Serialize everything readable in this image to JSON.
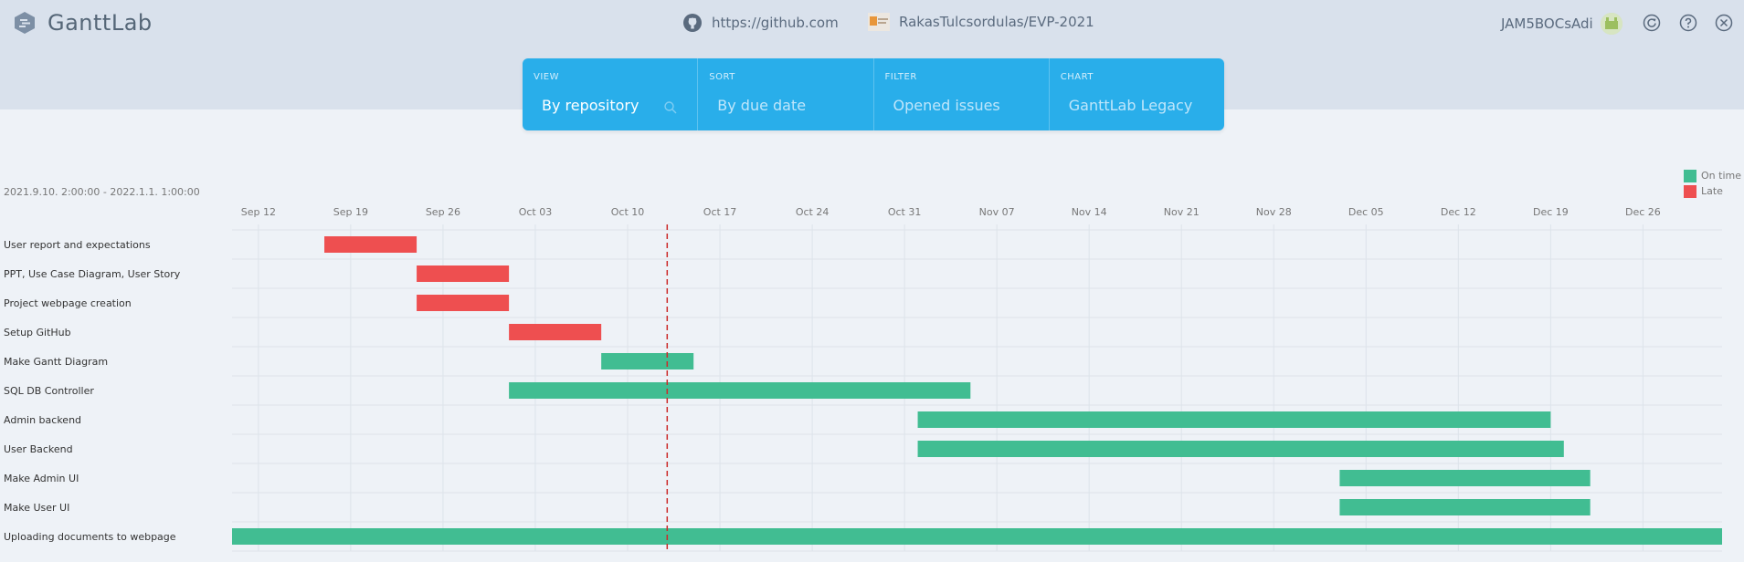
{
  "app": {
    "title": "GanttLab",
    "source_url": "https://github.com",
    "project": "RakasTulcsordulas/EVP-2021",
    "username": "JAM5BOCsAdi"
  },
  "controls": {
    "view": {
      "label": "VIEW",
      "value": "By repository"
    },
    "sort": {
      "label": "SORT",
      "value": "By due date"
    },
    "filter": {
      "label": "FILTER",
      "value": "Opened issues"
    },
    "chart": {
      "label": "CHART",
      "value": "GanttLab Legacy"
    }
  },
  "icons": {
    "logo": "gantt-logo-icon",
    "source": "github-icon",
    "project": "project-avatar-icon",
    "user": "user-avatar-icon",
    "refresh": "refresh-icon",
    "help": "help-icon",
    "close": "close-icon",
    "search": "search-icon"
  },
  "colors": {
    "header_bg": "#d9e1ec",
    "panel_bg": "#29aeea",
    "on_time": "#41bd92",
    "late": "#ee4f50",
    "today_line": "#cc2b2b",
    "grid": "#dde3ea"
  },
  "chart_data": {
    "type": "gantt",
    "date_range": "2021.9.10. 2:00:00 - 2022.1.1. 1:00:00",
    "x_axis": {
      "start": "2021-09-10",
      "end": "2022-01-01",
      "ticks": [
        {
          "label": "Sep 12",
          "date": "2021-09-12"
        },
        {
          "label": "Sep 19",
          "date": "2021-09-19"
        },
        {
          "label": "Sep 26",
          "date": "2021-09-26"
        },
        {
          "label": "Oct 03",
          "date": "2021-10-03"
        },
        {
          "label": "Oct 10",
          "date": "2021-10-10"
        },
        {
          "label": "Oct 17",
          "date": "2021-10-17"
        },
        {
          "label": "Oct 24",
          "date": "2021-10-24"
        },
        {
          "label": "Oct 31",
          "date": "2021-10-31"
        },
        {
          "label": "Nov 07",
          "date": "2021-11-07"
        },
        {
          "label": "Nov 14",
          "date": "2021-11-14"
        },
        {
          "label": "Nov 21",
          "date": "2021-11-21"
        },
        {
          "label": "Nov 28",
          "date": "2021-11-28"
        },
        {
          "label": "Dec 05",
          "date": "2021-12-05"
        },
        {
          "label": "Dec 12",
          "date": "2021-12-12"
        },
        {
          "label": "Dec 19",
          "date": "2021-12-19"
        },
        {
          "label": "Dec 26",
          "date": "2021-12-26"
        }
      ]
    },
    "today": "2021-10-13",
    "legend": [
      {
        "name": "On time",
        "color": "#41bd92"
      },
      {
        "name": "Late",
        "color": "#ee4f50"
      }
    ],
    "tasks": [
      {
        "name": "User report and expectations",
        "start": "2021-09-17",
        "end": "2021-09-24",
        "status": "Late"
      },
      {
        "name": "PPT, Use Case Diagram, User Story",
        "start": "2021-09-24",
        "end": "2021-10-01",
        "status": "Late"
      },
      {
        "name": "Project webpage creation",
        "start": "2021-09-24",
        "end": "2021-10-01",
        "status": "Late"
      },
      {
        "name": "Setup GitHub",
        "start": "2021-10-01",
        "end": "2021-10-08",
        "status": "Late"
      },
      {
        "name": "Make Gantt Diagram",
        "start": "2021-10-08",
        "end": "2021-10-15",
        "status": "On time"
      },
      {
        "name": "SQL DB Controller",
        "start": "2021-10-01",
        "end": "2021-11-05",
        "status": "On time"
      },
      {
        "name": "Admin backend",
        "start": "2021-11-01",
        "end": "2021-12-19",
        "status": "On time"
      },
      {
        "name": "User Backend",
        "start": "2021-11-01",
        "end": "2021-12-20",
        "status": "On time"
      },
      {
        "name": "Make Admin UI",
        "start": "2021-12-03",
        "end": "2021-12-22",
        "status": "On time"
      },
      {
        "name": "Make User UI",
        "start": "2021-12-03",
        "end": "2021-12-22",
        "status": "On time"
      },
      {
        "name": "Uploading documents to webpage",
        "start": "2021-09-10",
        "end": "2022-01-01",
        "status": "On time"
      }
    ]
  }
}
